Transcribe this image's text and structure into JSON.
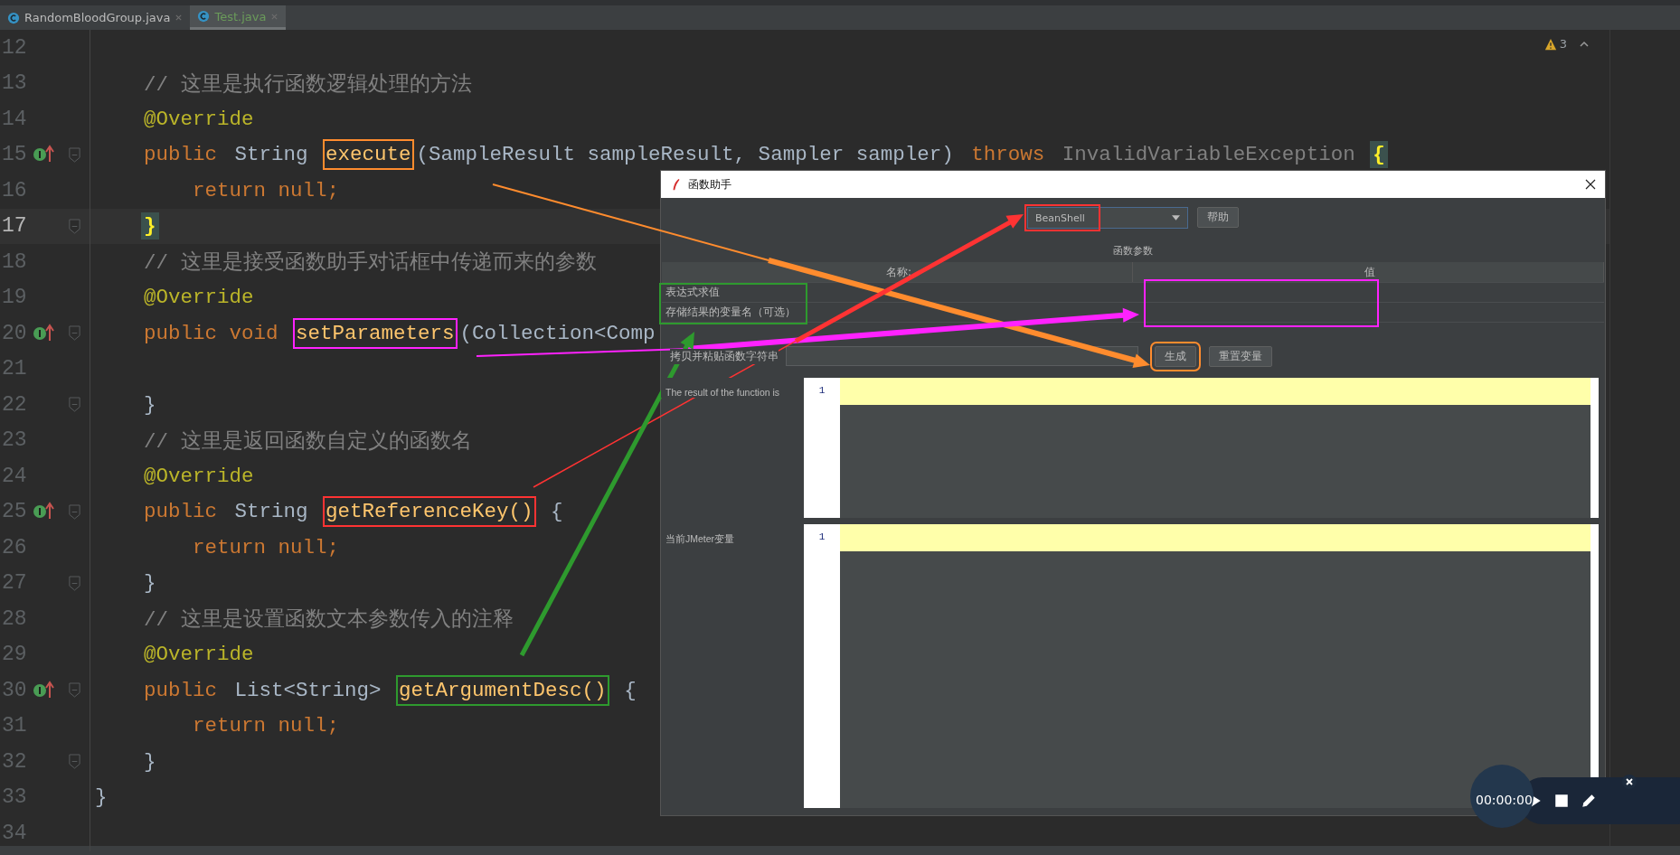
{
  "tabs": [
    {
      "label": "RandomBloodGroup.java",
      "selected": false
    },
    {
      "label": "Test.java",
      "selected": true
    }
  ],
  "warnings": {
    "count": "3"
  },
  "code_lines": [
    {
      "number": "12",
      "current": false,
      "marker": false,
      "fold": false
    },
    {
      "number": "13",
      "current": false,
      "marker": false,
      "fold": false,
      "tokens": [
        {
          "text": "    // 这里是执行函数逻辑处理的方法",
          "kind": "comment"
        }
      ]
    },
    {
      "number": "14",
      "current": false,
      "marker": false,
      "fold": false,
      "tokens": [
        {
          "text": "    @Override",
          "kind": "annotation"
        }
      ]
    },
    {
      "number": "15",
      "current": false,
      "marker": true,
      "fold": true,
      "tokens": [
        {
          "text": "    public ",
          "kind": "keyword"
        },
        {
          "text": "String ",
          "kind": "plain"
        },
        {
          "text": "execute",
          "kind": "method",
          "color": "#ff8c2e"
        },
        {
          "text": "(SampleResult sampleResult, Sampler sampler) ",
          "kind": "plain"
        },
        {
          "text": "throws ",
          "kind": "keyword"
        },
        {
          "text": "InvalidVariableException ",
          "kind": "unused"
        },
        {
          "text": "{",
          "kind": "brace_match"
        }
      ]
    },
    {
      "number": "16",
      "current": false,
      "marker": false,
      "fold": false,
      "tokens": [
        {
          "text": "        return null;",
          "kind": "keyword"
        }
      ]
    },
    {
      "number": "17",
      "current": true,
      "marker": false,
      "fold": true,
      "tokens": [
        {
          "text": "    }",
          "kind": "brace_match"
        }
      ]
    },
    {
      "number": "18",
      "current": false,
      "marker": false,
      "fold": false,
      "tokens": [
        {
          "text": "    // 这里是接受函数助手对话框中传递而来的参数",
          "kind": "comment"
        }
      ]
    },
    {
      "number": "19",
      "current": false,
      "marker": false,
      "fold": false,
      "tokens": [
        {
          "text": "    @Override",
          "kind": "annotation"
        }
      ]
    },
    {
      "number": "20",
      "current": false,
      "marker": true,
      "fold": true,
      "tokens": [
        {
          "text": "    public void ",
          "kind": "keyword"
        },
        {
          "text": "setParameters",
          "kind": "method",
          "color": "#ff22ff"
        },
        {
          "text": "(Collection<Comp",
          "kind": "plain"
        }
      ]
    },
    {
      "number": "21",
      "current": false,
      "marker": false,
      "fold": false
    },
    {
      "number": "22",
      "current": false,
      "marker": false,
      "fold": true,
      "tokens": [
        {
          "text": "    }",
          "kind": "plain"
        }
      ]
    },
    {
      "number": "23",
      "current": false,
      "marker": false,
      "fold": false,
      "tokens": [
        {
          "text": "    // 这里是返回函数自定义的函数名",
          "kind": "comment"
        }
      ]
    },
    {
      "number": "24",
      "current": false,
      "marker": false,
      "fold": false,
      "tokens": [
        {
          "text": "    @Override",
          "kind": "annotation"
        }
      ]
    },
    {
      "number": "25",
      "current": false,
      "marker": true,
      "fold": true,
      "tokens": [
        {
          "text": "    public ",
          "kind": "keyword"
        },
        {
          "text": "String ",
          "kind": "plain"
        },
        {
          "text": "getReferenceKey()",
          "kind": "method",
          "color": "#ff3333"
        },
        {
          "text": " {",
          "kind": "plain"
        }
      ]
    },
    {
      "number": "26",
      "current": false,
      "marker": false,
      "fold": false,
      "tokens": [
        {
          "text": "        return null;",
          "kind": "keyword"
        }
      ]
    },
    {
      "number": "27",
      "current": false,
      "marker": false,
      "fold": true,
      "tokens": [
        {
          "text": "    }",
          "kind": "plain"
        }
      ]
    },
    {
      "number": "28",
      "current": false,
      "marker": false,
      "fold": false,
      "tokens": [
        {
          "text": "    // 这里是设置函数文本参数传入的注释",
          "kind": "comment"
        }
      ]
    },
    {
      "number": "29",
      "current": false,
      "marker": false,
      "fold": false,
      "tokens": [
        {
          "text": "    @Override",
          "kind": "annotation"
        }
      ]
    },
    {
      "number": "30",
      "current": false,
      "marker": true,
      "fold": true,
      "tokens": [
        {
          "text": "    public ",
          "kind": "keyword"
        },
        {
          "text": "List<String> ",
          "kind": "plain"
        },
        {
          "text": "getArgumentDesc()",
          "kind": "method",
          "color": "#2e9a2e"
        },
        {
          "text": " {",
          "kind": "plain"
        }
      ]
    },
    {
      "number": "31",
      "current": false,
      "marker": false,
      "fold": false,
      "tokens": [
        {
          "text": "        return null;",
          "kind": "keyword"
        }
      ]
    },
    {
      "number": "32",
      "current": false,
      "marker": false,
      "fold": true,
      "tokens": [
        {
          "text": "    }",
          "kind": "plain"
        }
      ]
    },
    {
      "number": "33",
      "current": false,
      "marker": false,
      "fold": false,
      "tokens": [
        {
          "text": "}",
          "kind": "plain"
        }
      ]
    },
    {
      "number": "34",
      "current": false,
      "marker": false,
      "fold": false
    }
  ],
  "dialog": {
    "title": "函数助手",
    "function_select": {
      "value": "BeanShell"
    },
    "help_button": "帮助",
    "params_label": "函数参数",
    "params_table": {
      "columns": [
        "名称:",
        "值"
      ],
      "rows": [
        {
          "name": "表达式求值"
        },
        {
          "name": "存储结果的变量名（可选）"
        }
      ]
    },
    "paste_label": "拷贝并粘贴函数字符串",
    "generate_button": "生成",
    "reset_button": "重置变量",
    "result": {
      "label": "The result of the function is",
      "line_number": "1"
    },
    "variables": {
      "label": "当前JMeter变量",
      "line_number": "1"
    }
  },
  "recorder": {
    "time": "00:00:00"
  }
}
